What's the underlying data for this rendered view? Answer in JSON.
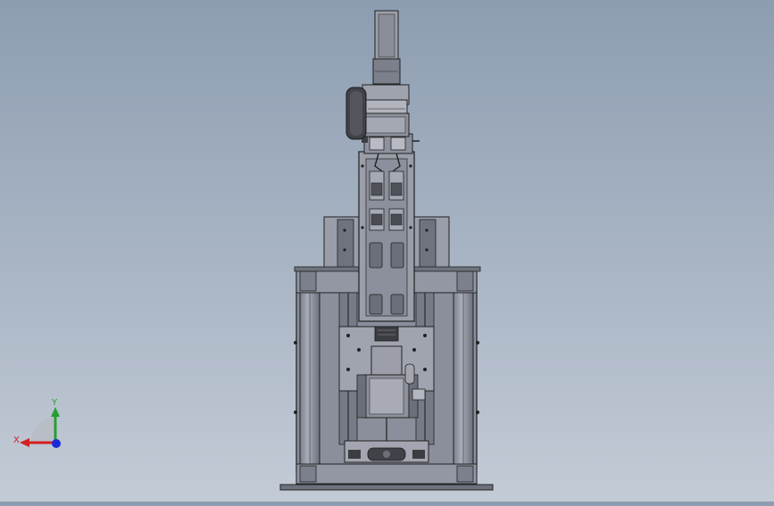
{
  "viewport": {
    "background_top": "#8d9db1",
    "background_bottom": "#c3cbd6",
    "model_colors": {
      "body": "#8a8e9c",
      "dark": "#3c3e44",
      "light": "#b5b8c2",
      "edge": "#222326",
      "accent_gold": "#c8a43a"
    }
  },
  "triad": {
    "x_label": "X",
    "y_label": "Y",
    "x_color": "#d42020",
    "y_color": "#25a030",
    "z_color": "#1a2ad8"
  }
}
